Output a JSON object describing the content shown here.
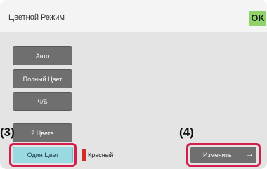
{
  "window": {
    "title": "Цветной Режим",
    "ok_label": "OK"
  },
  "modes": [
    {
      "label": "Авто"
    },
    {
      "label": "Полный Цвет"
    },
    {
      "label": "Ч/Б"
    },
    {
      "label": "2 Цвета"
    }
  ],
  "single_color": {
    "label": "Один Цвет",
    "color_name": "Красный",
    "swatch_color": "#d42b2b"
  },
  "change_button": {
    "label": "Изменить"
  },
  "callouts": {
    "left": "(3)",
    "right": "(4)"
  },
  "colors": {
    "highlight_frame": "#d31d4d",
    "ok_green": "#8fd36a",
    "selected_button": "#9ad9e0"
  }
}
